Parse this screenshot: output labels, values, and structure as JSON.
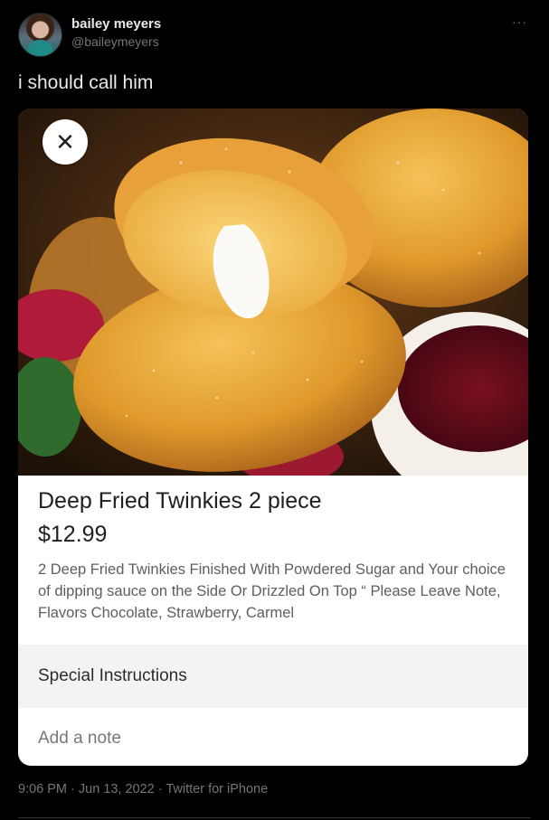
{
  "author": {
    "display_name": "bailey meyers",
    "handle": "@baileymeyers"
  },
  "tweet": {
    "text": "i should call him",
    "timestamp": "9:06 PM · Jun 13, 2022 · Twitter for iPhone"
  },
  "menu": {
    "more_label": "···"
  },
  "card": {
    "close_label": "✕",
    "item_title": "Deep Fried Twinkies 2 piece",
    "item_price": "$12.99",
    "item_description": "2 Deep Fried Twinkies Finished With Powdered Sugar and Your choice of dipping sauce on the Side Or Drizzled On Top “ Please Leave Note, Flavors Chocolate, Strawberry, Carmel",
    "special_instructions_label": "Special Instructions",
    "note_placeholder": "Add a note"
  }
}
